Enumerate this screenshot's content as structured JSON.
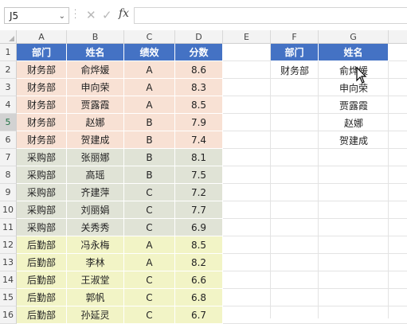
{
  "formula_bar": {
    "name_box": "J5",
    "fx_label": "fx",
    "formula": ""
  },
  "columns": [
    "A",
    "B",
    "C",
    "D",
    "E",
    "F",
    "G"
  ],
  "rows": [
    "1",
    "2",
    "3",
    "4",
    "5",
    "6",
    "7",
    "8",
    "9",
    "10",
    "11",
    "12",
    "13",
    "14",
    "15",
    "16"
  ],
  "selected_row": "5",
  "table": {
    "headers": [
      "部门",
      "姓名",
      "绩效",
      "分数"
    ],
    "rows": [
      [
        "财务部",
        "俞烨媛",
        "A",
        "8.6"
      ],
      [
        "财务部",
        "申向荣",
        "A",
        "8.3"
      ],
      [
        "财务部",
        "贾露霞",
        "A",
        "8.5"
      ],
      [
        "财务部",
        "赵娜",
        "B",
        "7.9"
      ],
      [
        "财务部",
        "贺建成",
        "B",
        "7.4"
      ],
      [
        "采购部",
        "张丽娜",
        "B",
        "8.1"
      ],
      [
        "采购部",
        "高瑶",
        "B",
        "7.5"
      ],
      [
        "采购部",
        "齐建萍",
        "C",
        "7.2"
      ],
      [
        "采购部",
        "刘丽娟",
        "C",
        "7.7"
      ],
      [
        "采购部",
        "关秀秀",
        "C",
        "6.9"
      ],
      [
        "后勤部",
        "冯永梅",
        "A",
        "8.5"
      ],
      [
        "后勤部",
        "李林",
        "A",
        "8.2"
      ],
      [
        "后勤部",
        "王淑堂",
        "C",
        "6.6"
      ],
      [
        "后勤部",
        "郭帆",
        "C",
        "6.8"
      ],
      [
        "后勤部",
        "孙延灵",
        "C",
        "6.7"
      ]
    ]
  },
  "result": {
    "headers": [
      "部门",
      "姓名"
    ],
    "dept": "财务部",
    "names": [
      "俞烨媛",
      "申向荣",
      "贾露霞",
      "赵娜",
      "贺建成"
    ]
  },
  "colors": {
    "header_blue": "#4472c4",
    "finance_fill": "#f8e1d4",
    "purchasing_fill": "#e0e3d6",
    "logistics_fill": "#f2f4c6"
  }
}
